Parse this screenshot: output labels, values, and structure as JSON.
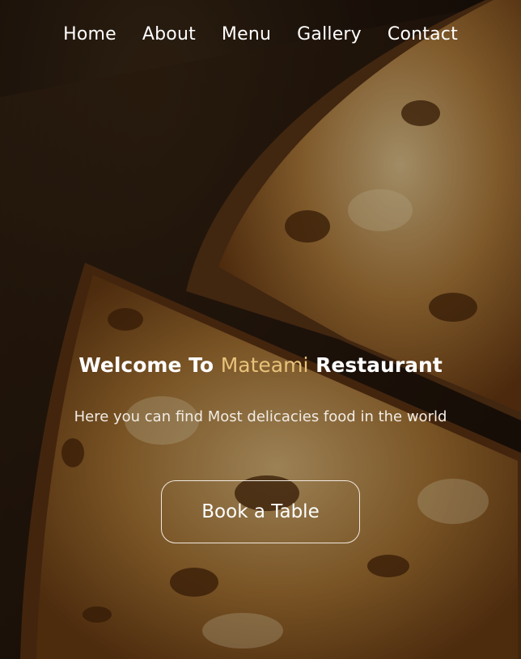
{
  "nav": {
    "items": [
      {
        "label": "Home"
      },
      {
        "label": "About"
      },
      {
        "label": "Menu"
      },
      {
        "label": "Gallery"
      },
      {
        "label": "Contact"
      }
    ]
  },
  "hero": {
    "title_prefix": "Welcome To ",
    "title_brand": "Mateami",
    "title_suffix": " Restaurant",
    "subtitle": "Here you can find Most delicacies food in the world",
    "cta_label": "Book a Table"
  },
  "colors": {
    "accent": "#e8c27a",
    "text": "#ffffff",
    "button_border": "#f0e8de"
  }
}
